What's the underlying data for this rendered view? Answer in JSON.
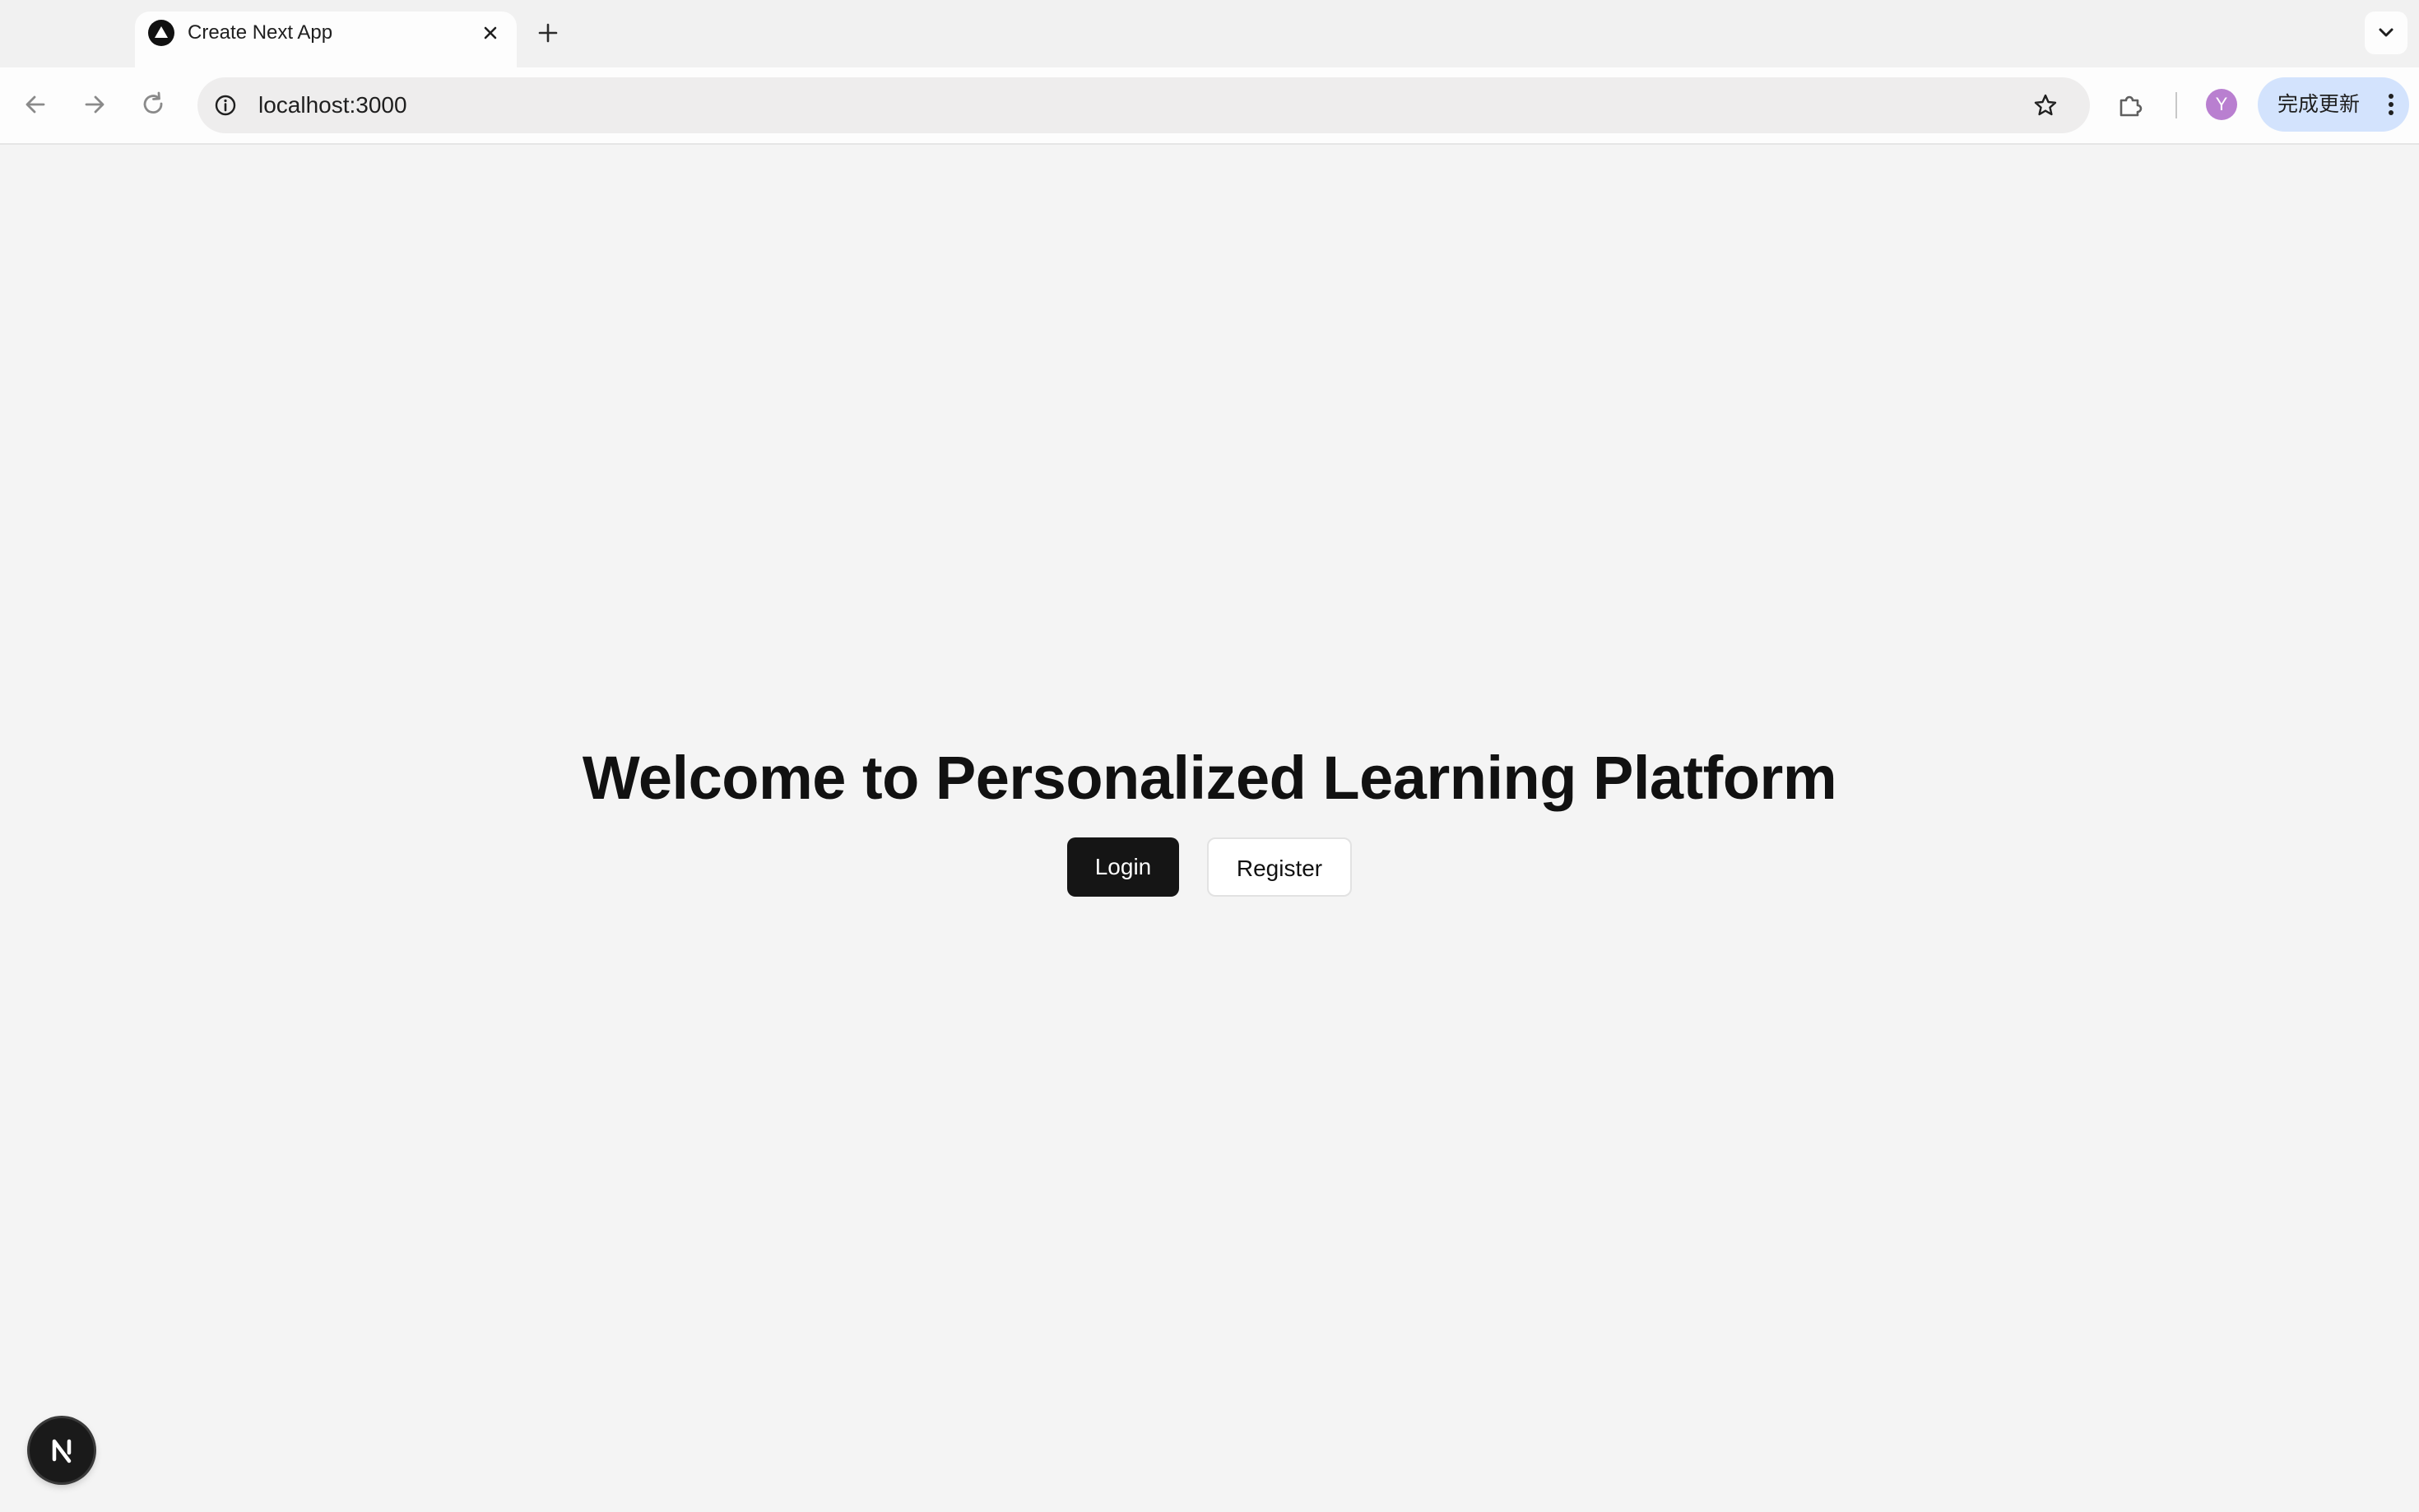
{
  "browser": {
    "tab": {
      "title": "Create Next App",
      "favicon": "nextjs-triangle-icon"
    },
    "toolbar": {
      "url": "localhost:3000",
      "profile_initial": "Y",
      "update_label": "完成更新"
    },
    "icons": {
      "back": "back-arrow-icon",
      "forward": "forward-arrow-icon",
      "reload": "reload-icon",
      "site_info": "info-icon",
      "bookmark": "star-icon",
      "extensions": "puzzle-icon",
      "menu": "kebab-menu-icon",
      "new_tab": "plus-icon",
      "close_tab": "close-icon",
      "tab_search": "chevron-down-icon"
    }
  },
  "page": {
    "heading": "Welcome to Personalized Learning Platform",
    "buttons": {
      "login": "Login",
      "register": "Register"
    },
    "dev_indicator": "N"
  },
  "colors": {
    "page_background": "#f4f4f4",
    "primary_button": "#151515",
    "update_button": "#d3e3fd",
    "avatar": "#b97fd0"
  }
}
